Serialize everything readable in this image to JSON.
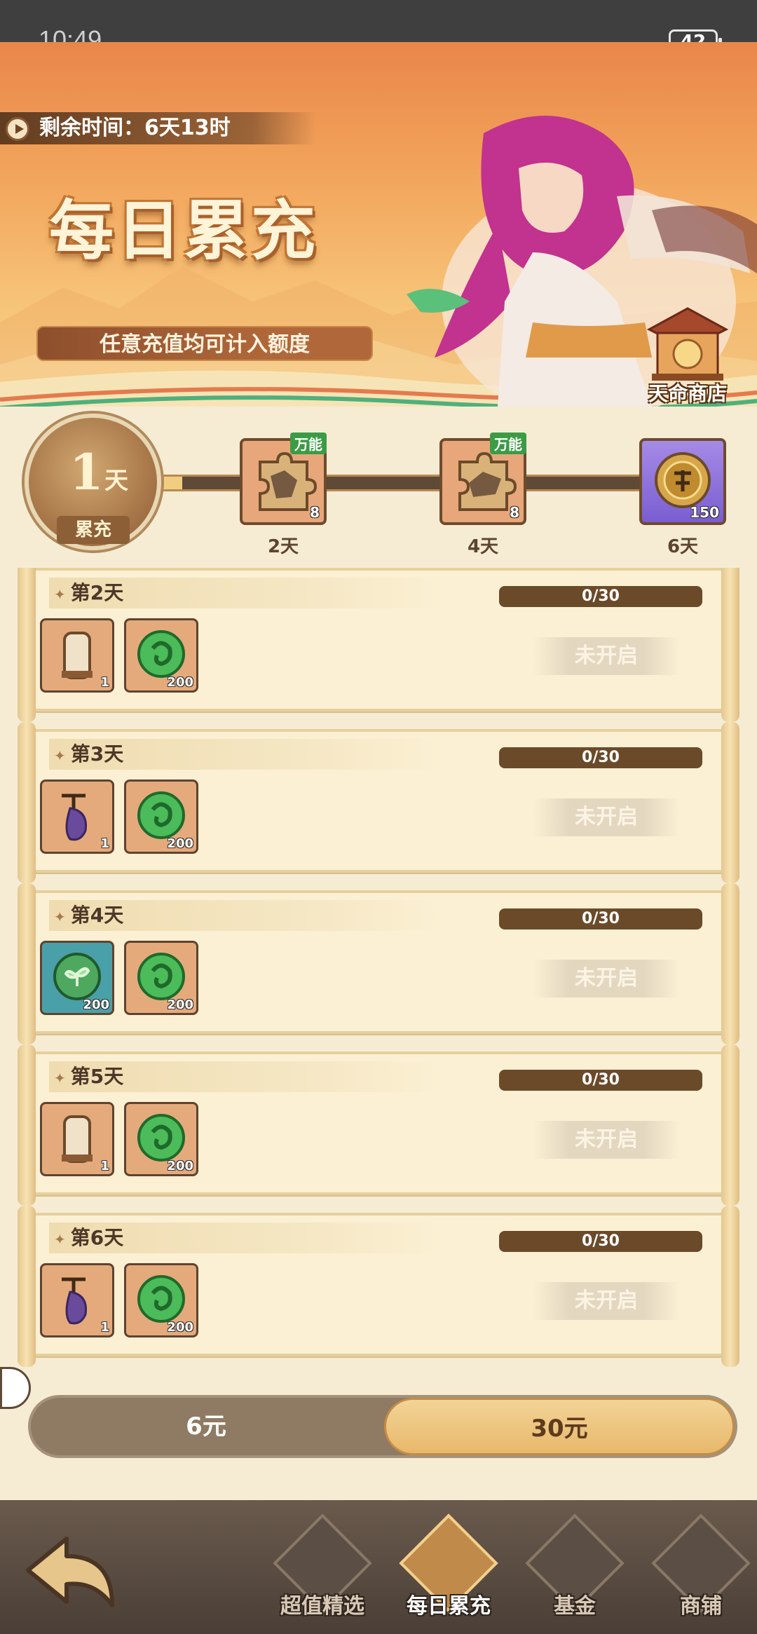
{
  "status_bar": {
    "time": "10:49",
    "battery": "42"
  },
  "hero": {
    "timer": "剩余时间：6天13时",
    "title": "每日累充",
    "subtitle": "任意充值均可计入额度",
    "shop_label": "天命商店"
  },
  "progress": {
    "current_day_num": "1",
    "current_day_unit": "天",
    "current_label": "累充",
    "fill_fraction": 0.08,
    "milestones": [
      {
        "label": "2天",
        "tag": "万能",
        "count": "8",
        "icon": "puzzle-piece-icon"
      },
      {
        "label": "4天",
        "tag": "万能",
        "count": "8",
        "icon": "puzzle-piece-icon"
      },
      {
        "label": "6天",
        "tag": "",
        "count": "150",
        "icon": "destiny-coin-icon"
      }
    ]
  },
  "tasks": [
    {
      "title": "第2天",
      "progress": "0/30",
      "status": "未开启",
      "items": [
        {
          "icon": "scroll-icon",
          "qty": "1"
        },
        {
          "icon": "jade-coin-icon",
          "qty": "200"
        }
      ]
    },
    {
      "title": "第3天",
      "progress": "0/30",
      "status": "未开启",
      "items": [
        {
          "icon": "pouch-icon",
          "qty": "1"
        },
        {
          "icon": "jade-coin-icon",
          "qty": "200"
        }
      ]
    },
    {
      "title": "第4天",
      "progress": "0/30",
      "status": "未开启",
      "items": [
        {
          "icon": "leaf-coin-icon",
          "qty": "200"
        },
        {
          "icon": "jade-coin-icon",
          "qty": "200"
        }
      ]
    },
    {
      "title": "第5天",
      "progress": "0/30",
      "status": "未开启",
      "items": [
        {
          "icon": "scroll-icon",
          "qty": "1"
        },
        {
          "icon": "jade-coin-icon",
          "qty": "200"
        }
      ]
    },
    {
      "title": "第6天",
      "progress": "0/30",
      "status": "未开启",
      "items": [
        {
          "icon": "pouch-icon",
          "qty": "1"
        },
        {
          "icon": "jade-coin-icon",
          "qty": "200"
        }
      ]
    }
  ],
  "price_tabs": {
    "left": "6元",
    "right": "30元",
    "selected": "30元"
  },
  "nav": {
    "items": [
      {
        "label": "超值精选"
      },
      {
        "label": "每日累充",
        "active": true
      },
      {
        "label": "基金"
      },
      {
        "label": "商铺"
      }
    ]
  },
  "colors": {
    "accent": "#e8b86b",
    "brown": "#6b4a2a",
    "panel": "#f6ecd4"
  }
}
